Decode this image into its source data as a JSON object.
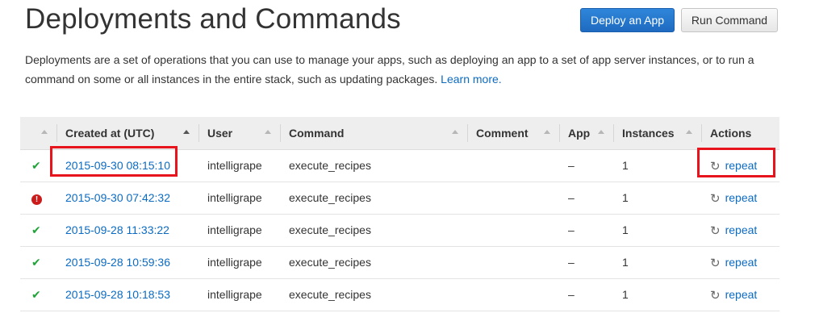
{
  "header": {
    "title": "Deployments and Commands",
    "deploy_button": "Deploy an App",
    "run_button": "Run Command"
  },
  "description": {
    "text": "Deployments are a set of operations that you can use to manage your apps, such as deploying an app to a set of app server instances, or to run a command on some or all instances in the entire stack, such as updating packages.",
    "link": "Learn more."
  },
  "table": {
    "columns": [
      "Created at (UTC)",
      "User",
      "Command",
      "Comment",
      "App",
      "Instances",
      "Actions"
    ],
    "rows": [
      {
        "status": "success",
        "status_icon": "check-icon",
        "created": "2015-09-30 08:15:10",
        "user": "intelligrape",
        "command": "execute_recipes",
        "comment": "",
        "app": "–",
        "instances": "1",
        "action": "repeat"
      },
      {
        "status": "failed",
        "status_icon": "error-icon",
        "created": "2015-09-30 07:42:32",
        "user": "intelligrape",
        "command": "execute_recipes",
        "comment": "",
        "app": "–",
        "instances": "1",
        "action": "repeat"
      },
      {
        "status": "success",
        "status_icon": "check-icon",
        "created": "2015-09-28 11:33:22",
        "user": "intelligrape",
        "command": "execute_recipes",
        "comment": "",
        "app": "–",
        "instances": "1",
        "action": "repeat"
      },
      {
        "status": "success",
        "status_icon": "check-icon",
        "created": "2015-09-28 10:59:36",
        "user": "intelligrape",
        "command": "execute_recipes",
        "comment": "",
        "app": "–",
        "instances": "1",
        "action": "repeat"
      },
      {
        "status": "success",
        "status_icon": "check-icon",
        "created": "2015-09-28 10:18:53",
        "user": "intelligrape",
        "command": "execute_recipes",
        "comment": "",
        "app": "–",
        "instances": "1",
        "action": "repeat"
      }
    ]
  },
  "colors": {
    "primary_button": "#1e6bc1",
    "link": "#0b6bc2",
    "success": "#22a33a",
    "error": "#cc1b1b",
    "highlight": "#e8141d"
  }
}
